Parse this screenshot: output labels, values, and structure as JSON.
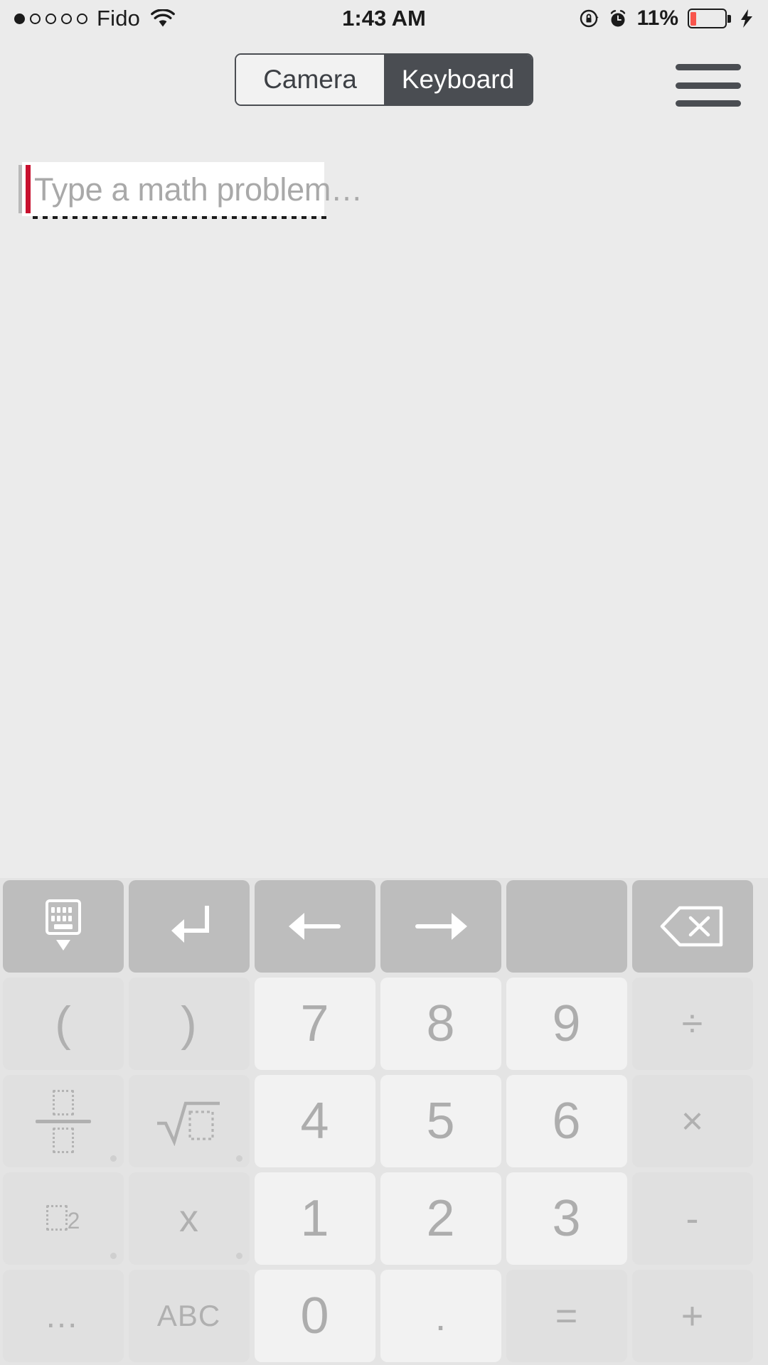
{
  "status_bar": {
    "signal_dots_total": 5,
    "signal_dots_filled": 1,
    "carrier": "Fido",
    "wifi_icon": "wifi-icon",
    "time": "1:43 AM",
    "rotation_lock_icon": "rotation-lock-icon",
    "alarm_icon": "alarm-clock-icon",
    "battery_percent": "11%",
    "battery_level": 11,
    "battery_fill_color": "#f8554c",
    "charging_icon": "lightning-bolt-icon"
  },
  "navbar": {
    "segments": [
      {
        "label": "Camera",
        "selected": false
      },
      {
        "label": "Keyboard",
        "selected": true
      }
    ],
    "menu_icon": "hamburger-menu-icon",
    "active_color": "#4a4d52",
    "inactive_color": "#f2f2f2"
  },
  "input": {
    "value": "",
    "placeholder": "Type a math problem…",
    "cursor_color": "#c8102e",
    "field_background": "#ffffff"
  },
  "keyboard": {
    "background": "#e4e4e4",
    "rows": [
      {
        "name": "function-row",
        "keys": [
          {
            "name": "hide-keyboard-key",
            "icon": "hide-keyboard-icon",
            "label": "",
            "style": "fn"
          },
          {
            "name": "return-key",
            "icon": "return-arrow-icon",
            "label": "",
            "style": "fn"
          },
          {
            "name": "cursor-left-key",
            "icon": "arrow-left-icon",
            "label": "",
            "style": "fn"
          },
          {
            "name": "cursor-right-key",
            "icon": "arrow-right-icon",
            "label": "",
            "style": "fn"
          },
          {
            "name": "blank-key",
            "icon": "",
            "label": "",
            "style": "blank"
          },
          {
            "name": "backspace-key",
            "icon": "backspace-icon",
            "label": "",
            "style": "fn"
          }
        ]
      },
      {
        "name": "row-7-8-9",
        "keys": [
          {
            "name": "open-paren-key",
            "icon": "",
            "label": "(",
            "style": "op"
          },
          {
            "name": "close-paren-key",
            "icon": "",
            "label": ")",
            "style": "op"
          },
          {
            "name": "digit-7-key",
            "icon": "",
            "label": "7",
            "style": "num"
          },
          {
            "name": "digit-8-key",
            "icon": "",
            "label": "8",
            "style": "num"
          },
          {
            "name": "digit-9-key",
            "icon": "",
            "label": "9",
            "style": "num"
          },
          {
            "name": "divide-key",
            "icon": "",
            "label": "÷",
            "style": "op"
          }
        ]
      },
      {
        "name": "row-4-5-6",
        "keys": [
          {
            "name": "fraction-key",
            "icon": "fraction-icon",
            "label": "",
            "style": "op",
            "longpress": true
          },
          {
            "name": "square-root-key",
            "icon": "square-root-icon",
            "label": "",
            "style": "op",
            "longpress": true
          },
          {
            "name": "digit-4-key",
            "icon": "",
            "label": "4",
            "style": "num"
          },
          {
            "name": "digit-5-key",
            "icon": "",
            "label": "5",
            "style": "num"
          },
          {
            "name": "digit-6-key",
            "icon": "",
            "label": "6",
            "style": "num"
          },
          {
            "name": "multiply-key",
            "icon": "",
            "label": "×",
            "style": "op"
          }
        ]
      },
      {
        "name": "row-1-2-3",
        "keys": [
          {
            "name": "power-key",
            "icon": "power-icon",
            "label": "",
            "style": "op",
            "longpress": true
          },
          {
            "name": "variable-x-key",
            "icon": "",
            "label": "x",
            "style": "op",
            "longpress": true
          },
          {
            "name": "digit-1-key",
            "icon": "",
            "label": "1",
            "style": "num"
          },
          {
            "name": "digit-2-key",
            "icon": "",
            "label": "2",
            "style": "num"
          },
          {
            "name": "digit-3-key",
            "icon": "",
            "label": "3",
            "style": "num"
          },
          {
            "name": "minus-key",
            "icon": "",
            "label": "-",
            "style": "op"
          }
        ]
      },
      {
        "name": "row-0-dot",
        "keys": [
          {
            "name": "more-symbols-key",
            "icon": "",
            "label": "…",
            "style": "op"
          },
          {
            "name": "abc-key",
            "icon": "",
            "label": "ABC",
            "style": "op"
          },
          {
            "name": "digit-0-key",
            "icon": "",
            "label": "0",
            "style": "num"
          },
          {
            "name": "decimal-point-key",
            "icon": "",
            "label": ".",
            "style": "num"
          },
          {
            "name": "equals-key",
            "icon": "",
            "label": "=",
            "style": "op"
          },
          {
            "name": "plus-key",
            "icon": "",
            "label": "+",
            "style": "op"
          }
        ]
      }
    ]
  }
}
